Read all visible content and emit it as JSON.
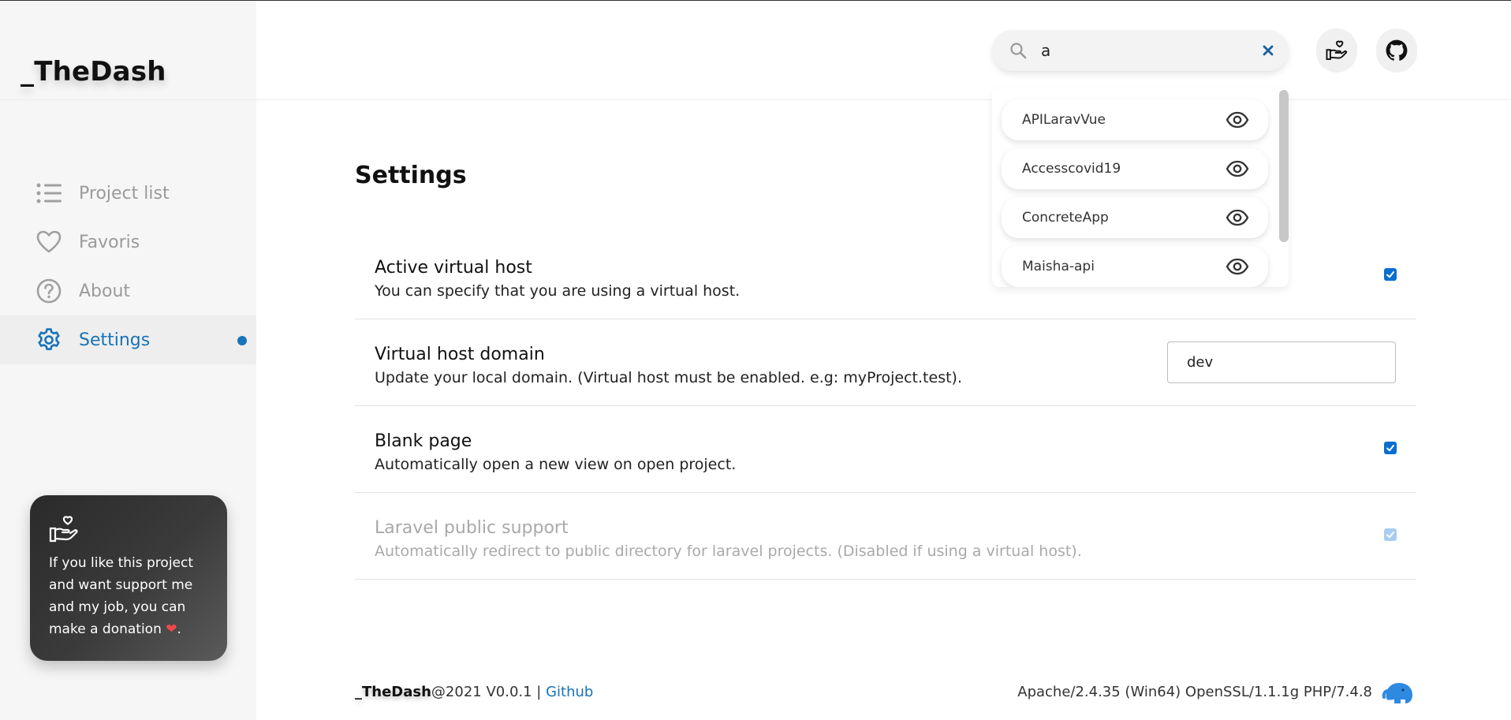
{
  "app": {
    "title": "_TheDash"
  },
  "sidebar": {
    "items": [
      {
        "label": "Project list",
        "icon": "list-icon"
      },
      {
        "label": "Favoris",
        "icon": "heart-icon"
      },
      {
        "label": "About",
        "icon": "question-icon"
      },
      {
        "label": "Settings",
        "icon": "gear-icon",
        "active": true
      }
    ],
    "donate": {
      "text": "If you like this project and want support me and my job, you can make a donation",
      "suffix": "."
    }
  },
  "header": {
    "search": {
      "value": "a",
      "placeholder": ""
    },
    "results": [
      {
        "name": "APILaravVue"
      },
      {
        "name": "Accesscovid19"
      },
      {
        "name": "ConcreteApp"
      },
      {
        "name": "Maisha-api"
      }
    ]
  },
  "main": {
    "title": "Settings",
    "settings": [
      {
        "title": "Active virtual host",
        "desc": "You can specify that you are using a virtual host.",
        "checked": true
      },
      {
        "title": "Virtual host domain",
        "desc": "Update your local domain. (Virtual host must be enabled. e.g: myProject.test).",
        "value": "dev"
      },
      {
        "title": "Blank page",
        "desc": "Automatically open a new view on open project.",
        "checked": true
      },
      {
        "title": "Laravel public support",
        "desc": "Automatically redirect to public directory for laravel projects. (Disabled if using a virtual host).",
        "checked": true,
        "disabled": true
      }
    ]
  },
  "footer": {
    "brand": "_TheDash",
    "version": "@2021 V0.0.1 | ",
    "github": "Github",
    "server": "Apache/2.4.35 (Win64) OpenSSL/1.1.1g PHP/7.4.8"
  },
  "colors": {
    "accent": "#1873b8",
    "checkbox": "#0a6ed1",
    "heart": "#ef4a4a"
  }
}
